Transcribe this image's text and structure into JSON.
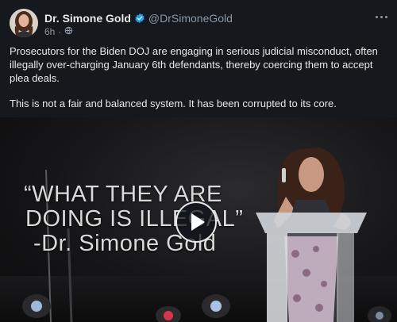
{
  "post": {
    "author": {
      "name": "Dr. Simone Gold",
      "handle": "@DrSimoneGold",
      "verified": true,
      "avatar": "avatar-photo"
    },
    "meta": {
      "time": "6h",
      "separator": "·",
      "privacy_icon": "globe-icon"
    },
    "more_icon": "more-dots-icon",
    "text": {
      "paragraph1": "Prosecutors for the Biden DOJ are engaging in serious judicial misconduct, often illegally over-charging January 6th defendants, thereby coercing them to accept plea deals.",
      "paragraph2": "This is not a fair and balanced system. It has been corrupted to its core."
    },
    "video": {
      "quote_line1": "“WHAT THEY ARE",
      "quote_line2": "DOING IS ILLEGAL”",
      "quote_line3": "-Dr. Simone Gold",
      "play_icon": "play-icon"
    }
  },
  "colors": {
    "background": "#15181c",
    "text": "#e7e9ea",
    "secondary_text": "#8b98a5",
    "verified_badge": "#1d9bf0"
  }
}
